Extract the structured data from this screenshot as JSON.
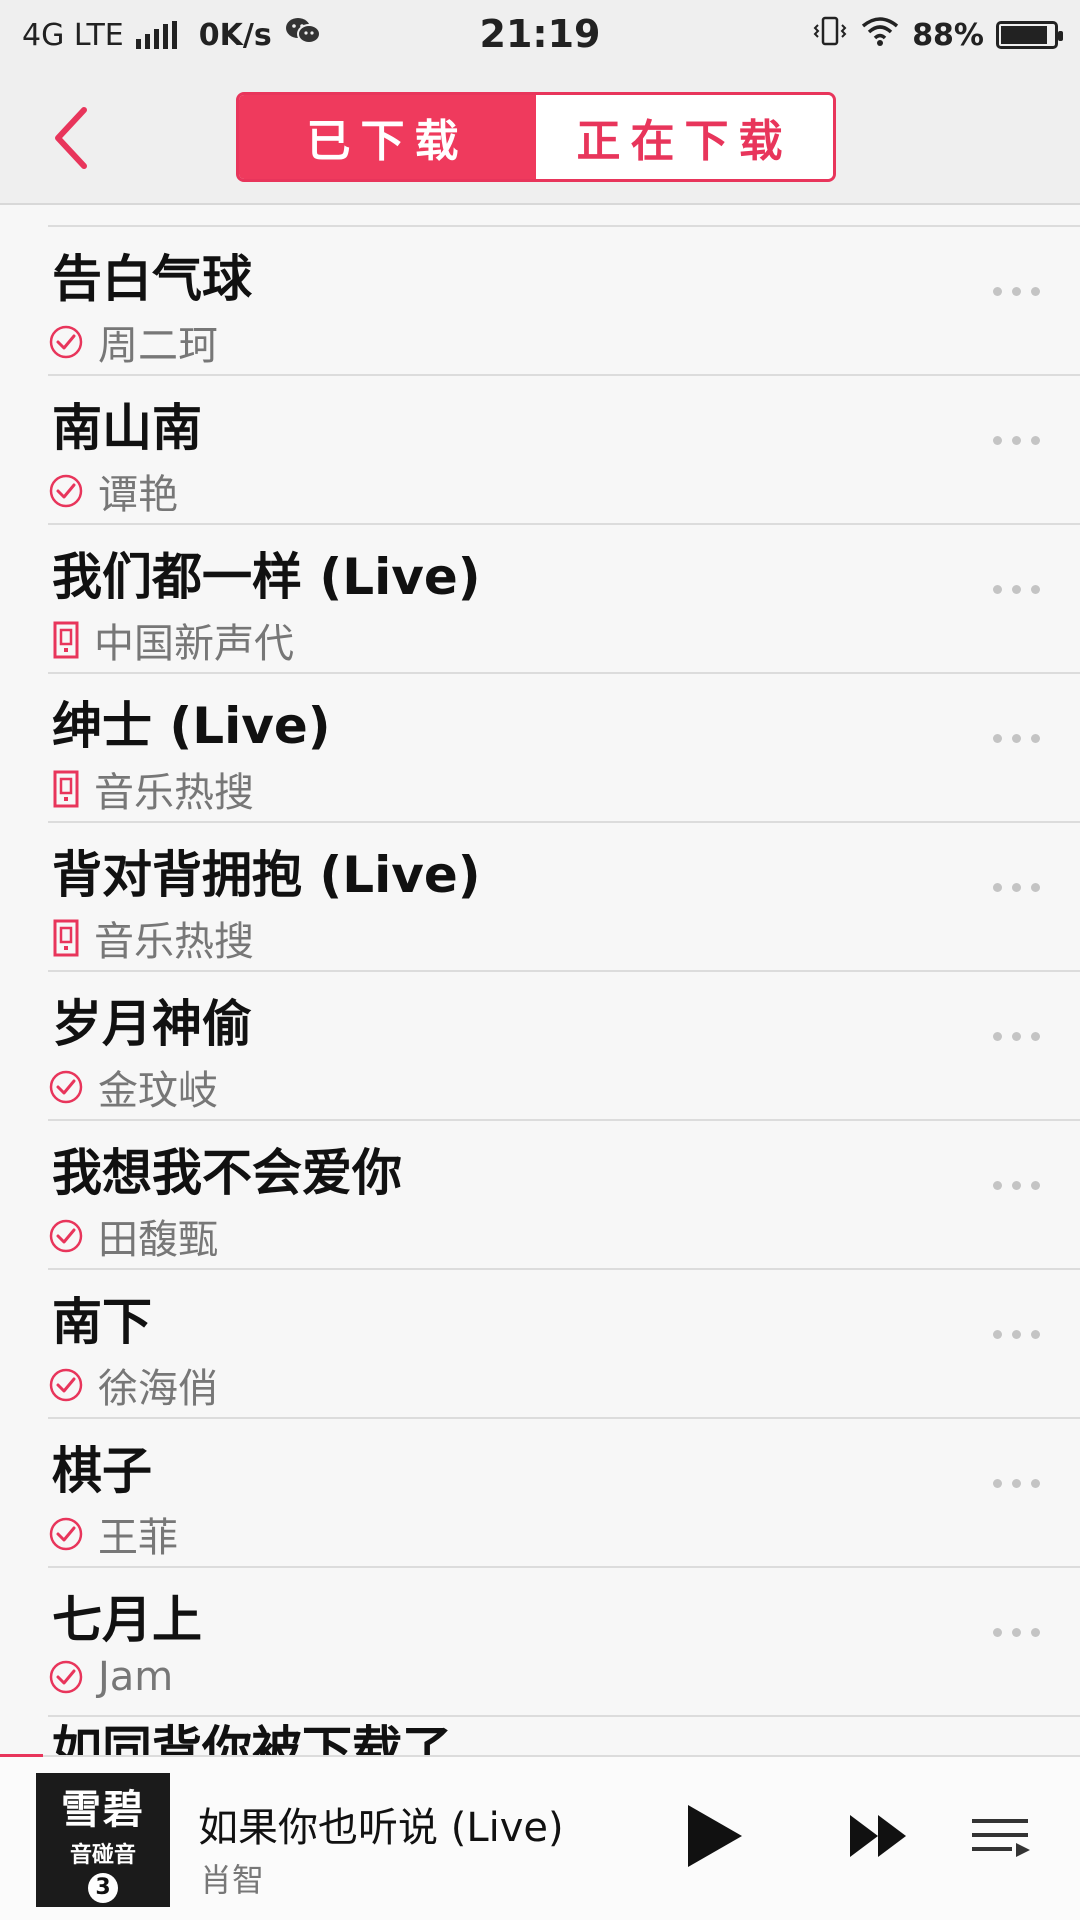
{
  "status": {
    "network": "4G LTE",
    "speed": "0K/s",
    "time": "21:19",
    "battery": "88%",
    "battery_level": 0.88
  },
  "nav": {
    "tab_downloaded": "已下载",
    "tab_downloading": "正在下载"
  },
  "songs": [
    {
      "title": "告白气球",
      "subtitle": "周二珂",
      "status_icon": "check-circle-icon"
    },
    {
      "title": "南山南",
      "subtitle": "谭艳",
      "status_icon": "check-circle-icon"
    },
    {
      "title": "我们都一样 (Live)",
      "subtitle": "中国新声代",
      "status_icon": "phone-icon"
    },
    {
      "title": "绅士 (Live)",
      "subtitle": "音乐热搜",
      "status_icon": "phone-icon"
    },
    {
      "title": "背对背拥抱 (Live)",
      "subtitle": "音乐热搜",
      "status_icon": "phone-icon"
    },
    {
      "title": "岁月神偷",
      "subtitle": "金玟岐",
      "status_icon": "check-circle-icon"
    },
    {
      "title": "我想我不会爱你",
      "subtitle": "田馥甄",
      "status_icon": "check-circle-icon"
    },
    {
      "title": "南下",
      "subtitle": "徐海俏",
      "status_icon": "check-circle-icon"
    },
    {
      "title": "棋子",
      "subtitle": "王菲",
      "status_icon": "check-circle-icon"
    },
    {
      "title": "七月上",
      "subtitle": "Jam",
      "status_icon": "check-circle-icon"
    }
  ],
  "peek_bottom": "如同背你被下载了",
  "player": {
    "cover_text": "雪碧",
    "cover_sub": "音碰音",
    "cover_num": "3",
    "title": "如果你也听说 (Live)",
    "artist": "肖智",
    "progress": 0.04
  },
  "colors": {
    "accent": "#e8355b"
  }
}
